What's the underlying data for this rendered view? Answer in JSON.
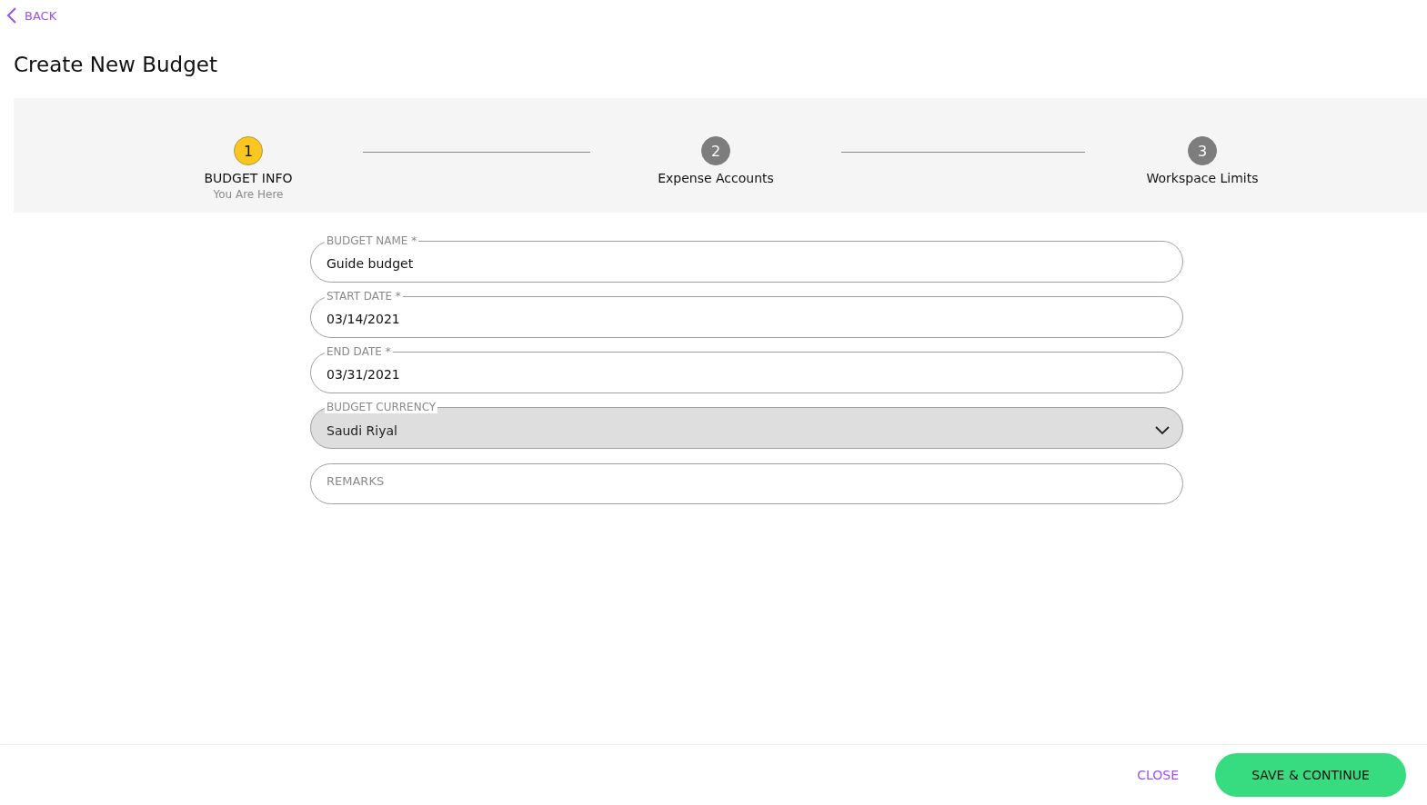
{
  "back_link": {
    "label": "BACK"
  },
  "title": "Create New Budget",
  "steps": [
    {
      "number": "1",
      "label": "BUDGET INFO",
      "subtitle": "You Are Here",
      "selected": true
    },
    {
      "number": "2",
      "label": "Expense Accounts",
      "selected": false
    },
    {
      "number": "3",
      "label": "Workspace Limits",
      "selected": false
    }
  ],
  "fields": [
    {
      "kind": "text",
      "label": "BUDGET NAME *",
      "value": "Guide budget"
    },
    {
      "kind": "text",
      "label": "START DATE *",
      "value": "03/14/2021"
    },
    {
      "kind": "text",
      "label": "END DATE *",
      "value": "03/31/2021"
    },
    {
      "kind": "select",
      "label": "BUDGET CURRENCY",
      "value": "Saudi Riyal"
    },
    {
      "kind": "text",
      "placeholder": "REMARKS"
    }
  ],
  "footer": {
    "close": "CLOSE",
    "save": "SAVE & CONTINUE"
  }
}
